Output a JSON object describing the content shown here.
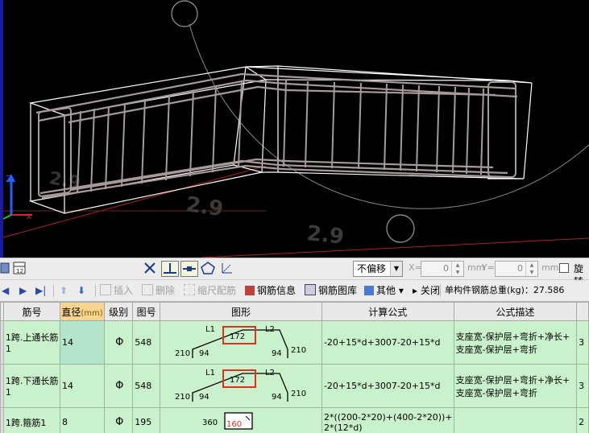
{
  "viewport": {
    "axis_labels": [
      "Z",
      "X"
    ],
    "ground_texts": [
      "2.9",
      "2.9",
      "2.9"
    ]
  },
  "toolbar1": {
    "offset_mode": "不偏移",
    "x_label": "X=",
    "x_value": "0",
    "x_unit": "mm",
    "y_label": "Y=",
    "y_value": "0",
    "y_unit": "mm",
    "rotate_label": "旋转"
  },
  "toolbar2": {
    "insert": "插入",
    "delete": "删除",
    "scale_bar": "缩尺配筋",
    "rebar_info": "钢筋信息",
    "rebar_library": "钢筋图库",
    "other": "其他",
    "close": "关闭",
    "total_weight": "单构件钢筋总重(kg)：27.586"
  },
  "table": {
    "headers": [
      "筋号",
      "直径",
      "(mm)",
      "级别",
      "图号",
      "图形",
      "计算公式",
      "公式描述"
    ],
    "rows": [
      {
        "name": "1跨.上通长筋1",
        "diameter": "14",
        "grade": "Φ",
        "figure_no": "548",
        "shape": {
          "l1": "L1",
          "l2": "L2",
          "mid": "172",
          "left_end": "210",
          "left_inner": "94",
          "right_inner": "94",
          "right_end": "210"
        },
        "formula": "-20+15*d+3007-20+15*d",
        "desc_1": "支座宽-保护层+弯折+净长+",
        "desc_2": "支座宽-保护层+弯折",
        "extra": "3"
      },
      {
        "name": "1跨.下通长筋1",
        "diameter": "14",
        "grade": "Φ",
        "figure_no": "548",
        "shape": {
          "l1": "L1",
          "l2": "L2",
          "mid": "172",
          "left_end": "210",
          "left_inner": "94",
          "right_inner": "94",
          "right_end": "210"
        },
        "formula": "-20+15*d+3007-20+15*d",
        "desc_1": "支座宽-保护层+弯折+净长+",
        "desc_2": "支座宽-保护层+弯折",
        "extra": "3"
      },
      {
        "name": "1跨.箍筋1",
        "diameter": "8",
        "grade": "Φ",
        "figure_no": "195",
        "shape": {
          "width": "360",
          "height": "160"
        },
        "formula_1": "2*((200-2*20)+(400-2*20))+",
        "formula_2": "2*(12*d)",
        "desc_1": "",
        "extra": "2"
      }
    ]
  },
  "colors": {
    "viewport_bg": "#000000",
    "rebar": "#a89a9a",
    "row_bg": "#c9f2cc",
    "header_highlight": "#f7d58e",
    "highlight_box": "#e03020"
  }
}
